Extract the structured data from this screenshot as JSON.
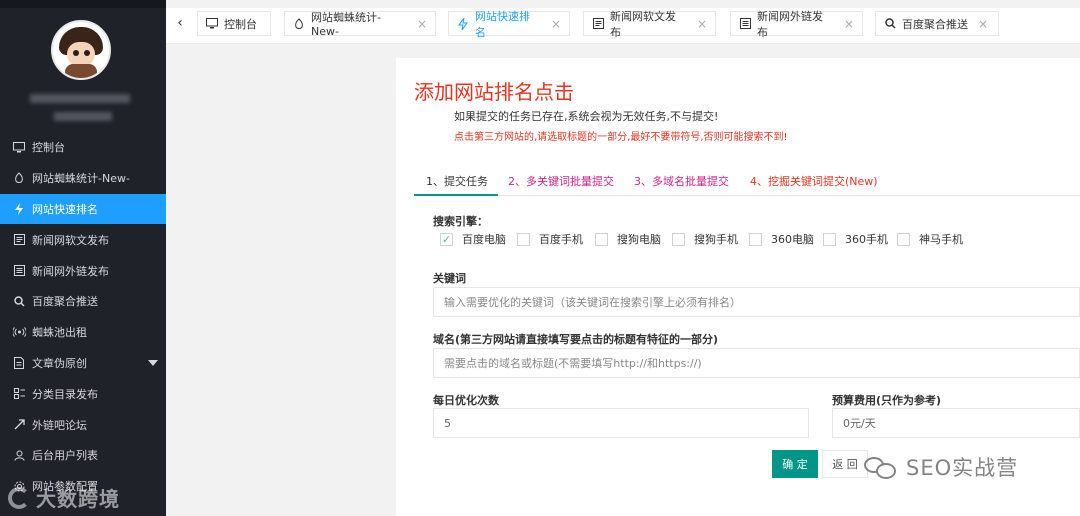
{
  "sidebar": {
    "items": [
      {
        "label": "控制台",
        "icon": "monitor-icon"
      },
      {
        "label": "网站蜘蛛统计-New-",
        "icon": "spider-icon"
      },
      {
        "label": "网站快速排名",
        "icon": "lightning-icon",
        "active": true
      },
      {
        "label": "新闻网软文发布",
        "icon": "newspaper-icon"
      },
      {
        "label": "新闻网外链发布",
        "icon": "list-icon"
      },
      {
        "label": "百度聚合推送",
        "icon": "search-icon"
      },
      {
        "label": "蜘蛛池出租",
        "icon": "broadcast-icon"
      },
      {
        "label": "文章伪原创",
        "icon": "document-icon",
        "has_submenu": true
      },
      {
        "label": "分类目录发布",
        "icon": "category-icon"
      },
      {
        "label": "外链吧论坛",
        "icon": "share-icon"
      },
      {
        "label": "后台用户列表",
        "icon": "user-icon"
      },
      {
        "label": "网站参数配置",
        "icon": "settings-icon"
      }
    ],
    "watermark": "大数跨境"
  },
  "tabs": [
    {
      "label": "控制台",
      "icon": "monitor-icon",
      "closable": false
    },
    {
      "label": "网站蜘蛛统计-New-",
      "icon": "spider-icon",
      "closable": true
    },
    {
      "label": "网站快速排名",
      "icon": "lightning-icon",
      "closable": true,
      "active": true
    },
    {
      "label": "新闻网软文发布",
      "icon": "newspaper-icon",
      "closable": true
    },
    {
      "label": "新闻网外链发布",
      "icon": "list-icon",
      "closable": true
    },
    {
      "label": "百度聚合推送",
      "icon": "search-icon",
      "closable": true
    }
  ],
  "page": {
    "title": "添加网站排名点击",
    "note1": "如果提交的任务已存在,系统会视为无效任务,不与提交!",
    "note2": "点击第三方网站的,请选取标题的一部分,最好不要带符号,否则可能搜索不到!",
    "subtabs": [
      "1、提交任务",
      "2、多关键词批量提交",
      "3、多域名批量提交",
      "4、挖掘关键词提交(New)"
    ]
  },
  "form": {
    "engine_label": "搜索引擎：",
    "engines": [
      {
        "label": "百度电脑",
        "checked": true
      },
      {
        "label": "百度手机",
        "checked": false
      },
      {
        "label": "搜狗电脑",
        "checked": false
      },
      {
        "label": "搜狗手机",
        "checked": false
      },
      {
        "label": "360电脑",
        "checked": false
      },
      {
        "label": "360手机",
        "checked": false
      },
      {
        "label": "神马手机",
        "checked": false
      }
    ],
    "keyword_label": "关键词",
    "keyword_placeholder": "输入需要优化的关键词（该关键词在搜索引擎上必须有排名）",
    "domain_label": "域名(第三方网站请直接填写要点击的标题有特征的一部分)",
    "domain_placeholder": "需要点击的域名或标题(不需要填写http://和https://)",
    "daily_label": "每日优化次数",
    "daily_value": "5",
    "budget_label": "预算费用(只作为参考)",
    "budget_value": "0元/天",
    "ok_label": "确 定",
    "back_label": "返 回"
  },
  "watermark": "SEO实战营",
  "colors": {
    "sidebar_bg": "#20222a",
    "active_blue": "#1e9fff",
    "teal": "#009688",
    "red": "#e8341f"
  }
}
